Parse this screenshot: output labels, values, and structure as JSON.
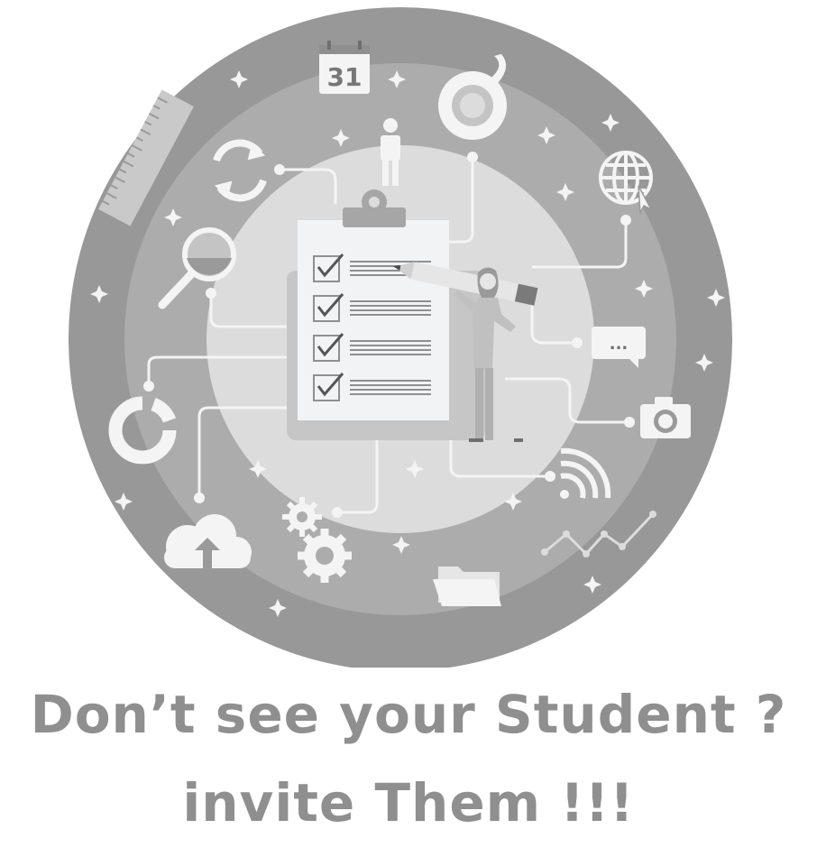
{
  "illustration": {
    "calendar_day": "31",
    "speech_bubble": "...",
    "colors": {
      "outer_ring": "#989898",
      "middle_ring": "#ababab",
      "inner_disc": "#dcdcdc",
      "clipboard": "#f2f3f5",
      "icon_white": "#f4f4f4",
      "text_gray": "#8f8f8f"
    },
    "icons": [
      "calendar-icon",
      "tape-icon",
      "person-icon",
      "refresh-icon",
      "globe-icon",
      "ruler-icon",
      "magnifier-icon",
      "clipboard-icon",
      "pencil-icon",
      "woman-figure",
      "chat-icon",
      "camera-icon",
      "donut-chart-icon",
      "wifi-icon",
      "cloud-upload-icon",
      "gears-icon",
      "folder-icon",
      "line-chart-icon"
    ]
  },
  "message": {
    "line1": "Don’t see your Student ?",
    "line2": "invite Them !!!"
  }
}
